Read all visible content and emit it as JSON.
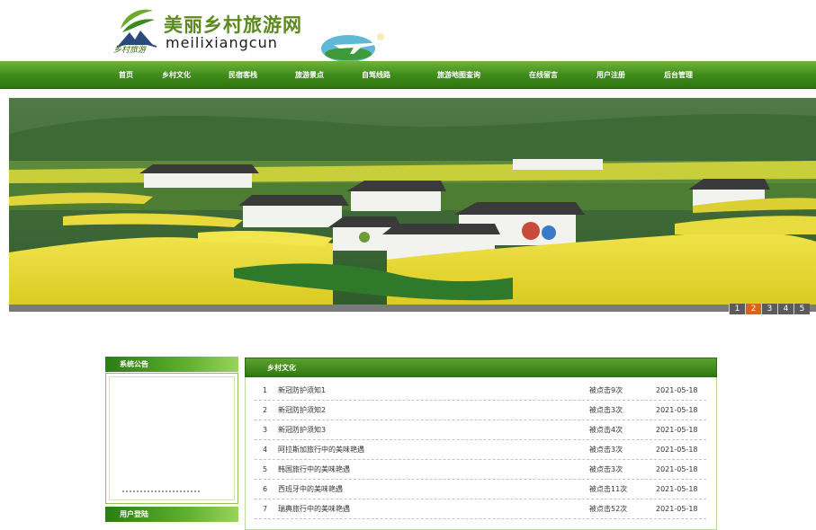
{
  "header": {
    "logo_title": "美丽乡村旅游网",
    "logo_sub": "meilixiangcun",
    "logo_script": "乡村旅游"
  },
  "nav": {
    "items": [
      {
        "label": "首页"
      },
      {
        "label": "乡村文化"
      },
      {
        "label": "民宿客栈"
      },
      {
        "label": "旅游景点"
      },
      {
        "label": "自驾线路"
      },
      {
        "label": "旅游地图查询"
      },
      {
        "label": "在线留言"
      },
      {
        "label": "用户注册"
      },
      {
        "label": "后台管理"
      }
    ]
  },
  "banner": {
    "slides": [
      "1",
      "2",
      "3",
      "4",
      "5"
    ],
    "active_slide": "2"
  },
  "sidebar": {
    "notice_title": "系统公告",
    "login_title": "用户登陆"
  },
  "main": {
    "section_title": "乡村文化",
    "rows": [
      {
        "num": "1",
        "title": "新冠防护须知1",
        "hits": "被点击9次",
        "date": "2021-05-18"
      },
      {
        "num": "2",
        "title": "新冠防护须知2",
        "hits": "被点击3次",
        "date": "2021-05-18"
      },
      {
        "num": "3",
        "title": "新冠防护须知3",
        "hits": "被点击4次",
        "date": "2021-05-18"
      },
      {
        "num": "4",
        "title": "阿拉斯加旅行中的美味艳遇",
        "hits": "被点击3次",
        "date": "2021-05-18"
      },
      {
        "num": "5",
        "title": "韩国旅行中的美味艳遇",
        "hits": "被点击3次",
        "date": "2021-05-18"
      },
      {
        "num": "6",
        "title": "西班牙中的美味艳遇",
        "hits": "被点击11次",
        "date": "2021-05-18"
      },
      {
        "num": "7",
        "title": "瑞典旅行中的美味艳遇",
        "hits": "被点击52次",
        "date": "2021-05-18"
      }
    ]
  },
  "colors": {
    "nav_green": "#3d8a1a",
    "active_dot": "#e0601a",
    "logo_green": "#5c8a1e"
  }
}
